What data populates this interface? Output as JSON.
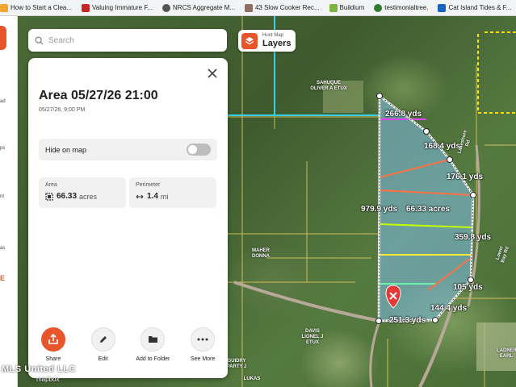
{
  "bookmarks": [
    {
      "label": "How to Start a Clea...",
      "icon": "bookmark-icon",
      "color": "#f4a62a"
    },
    {
      "label": "Valuing Immature F...",
      "icon": "flag-icon",
      "color": "#c62828"
    },
    {
      "label": "NRCS Aggregate M...",
      "icon": "globe-icon",
      "color": "#555555"
    },
    {
      "label": "43 Slow Cooker Rec...",
      "icon": "recipe-icon",
      "color": "#8d6e63"
    },
    {
      "label": "Buildium",
      "icon": "buildium-icon",
      "color": "#7cb342"
    },
    {
      "label": "testimonialtree.",
      "icon": "tree-icon",
      "color": "#2e7d32"
    },
    {
      "label": "Cat Island Tides & F...",
      "icon": "tide-icon",
      "color": "#1565c0"
    }
  ],
  "search": {
    "placeholder": "Search"
  },
  "layers": {
    "small": "Hunt Map",
    "label": "Layers"
  },
  "panel": {
    "title": "Area 05/27/26 21:00",
    "subtitle": "05/27/26, 9:00 PM",
    "hide_label": "Hide on map",
    "area": {
      "label": "Area",
      "value": "66.33",
      "unit": "acres"
    },
    "perimeter": {
      "label": "Perimeter",
      "value": "1.4",
      "unit": "mi"
    },
    "actions": [
      {
        "label": "Share",
        "icon": "share-icon"
      },
      {
        "label": "Edit",
        "icon": "pencil-icon"
      },
      {
        "label": "Add to Folder",
        "icon": "folder-icon"
      },
      {
        "label": "See More",
        "icon": "more-icon"
      }
    ]
  },
  "left_strip": {
    "labels": [
      "ad",
      "ps",
      "nt",
      "as"
    ],
    "orange": "E"
  },
  "map": {
    "measurements": [
      "266.8 yds",
      "168.4 yds",
      "176.1 yds",
      "979.9 yds",
      "66.33 acres",
      "359.8 yds",
      "105 yds",
      "144.4 yds",
      "251.3 yds"
    ],
    "owners": [
      "SAHUQUE OLIVER A ETUX",
      "MAHER DONNA",
      "DAVIS LIONEL J ETUX",
      "GUIDRY PARTY J",
      "LADNER EARL",
      "LUKAS"
    ],
    "roads": [
      "Lower Bay Rd",
      "Lakeshore Rd"
    ]
  },
  "watermark": "MLS United LLC",
  "attribution": "mapbox",
  "colors": {
    "accent": "#e8552a",
    "boundary": "#ffffff",
    "fill": "#7fbfe8"
  }
}
